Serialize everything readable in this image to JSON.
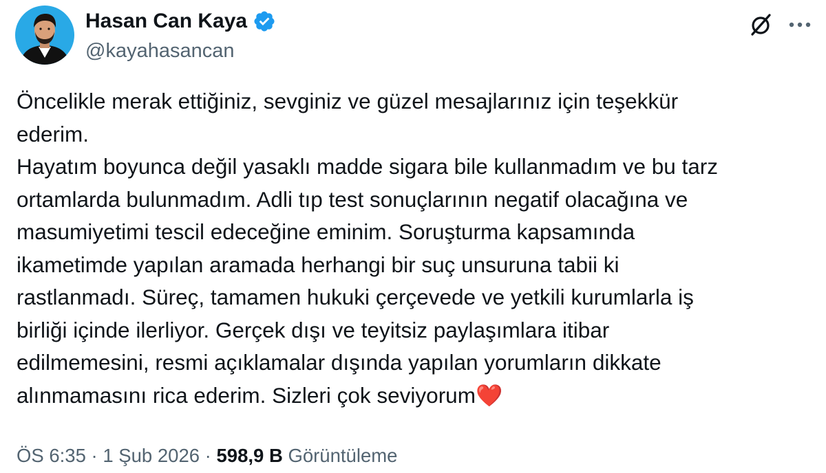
{
  "author": {
    "display_name": "Hasan Can Kaya",
    "handle": "@kayahasancan",
    "verified": true,
    "avatar_icon": "profile-photo"
  },
  "actions": {
    "grok_icon": "grok-icon",
    "more_icon": "more-options-icon"
  },
  "tweet": {
    "text": "Öncelikle merak ettiğiniz, sevginiz ve güzel mesajlarınız için teşekkür\nederim.\nHayatım boyunca değil yasaklı madde sigara bile kullanmadım ve bu tarz\nortamlarda bulunmadım. Adli tıp test sonuçlarının negatif olacağına ve\nmasumiyetimi tescil edeceğine eminim. Soruşturma kapsamında\nikametimde yapılan aramada herhangi bir suç unsuruna tabii ki\nrastlanmadı. Süreç, tamamen hukuki çerçevede ve yetkili kurumlarla iş\nbirliği içinde ilerliyor. Gerçek dışı ve teyitsiz paylaşımlara itibar\nedilmemesini, resmi açıklamalar dışında yapılan yorumların dikkate\nalınmamasını rica ederim. Sizleri çok seviyorum",
    "emoji": "❤️"
  },
  "meta": {
    "time": "ÖS 6:35",
    "separator": " · ",
    "date": "1 Şub 2026",
    "views_count": "598,9 B",
    "views_label": "Görüntüleme"
  },
  "colors": {
    "text": "#0f1419",
    "secondary": "#536471",
    "verified_blue": "#1d9bf0",
    "heart_red": "#e0245e",
    "avatar_bg": "#29a9e6"
  }
}
